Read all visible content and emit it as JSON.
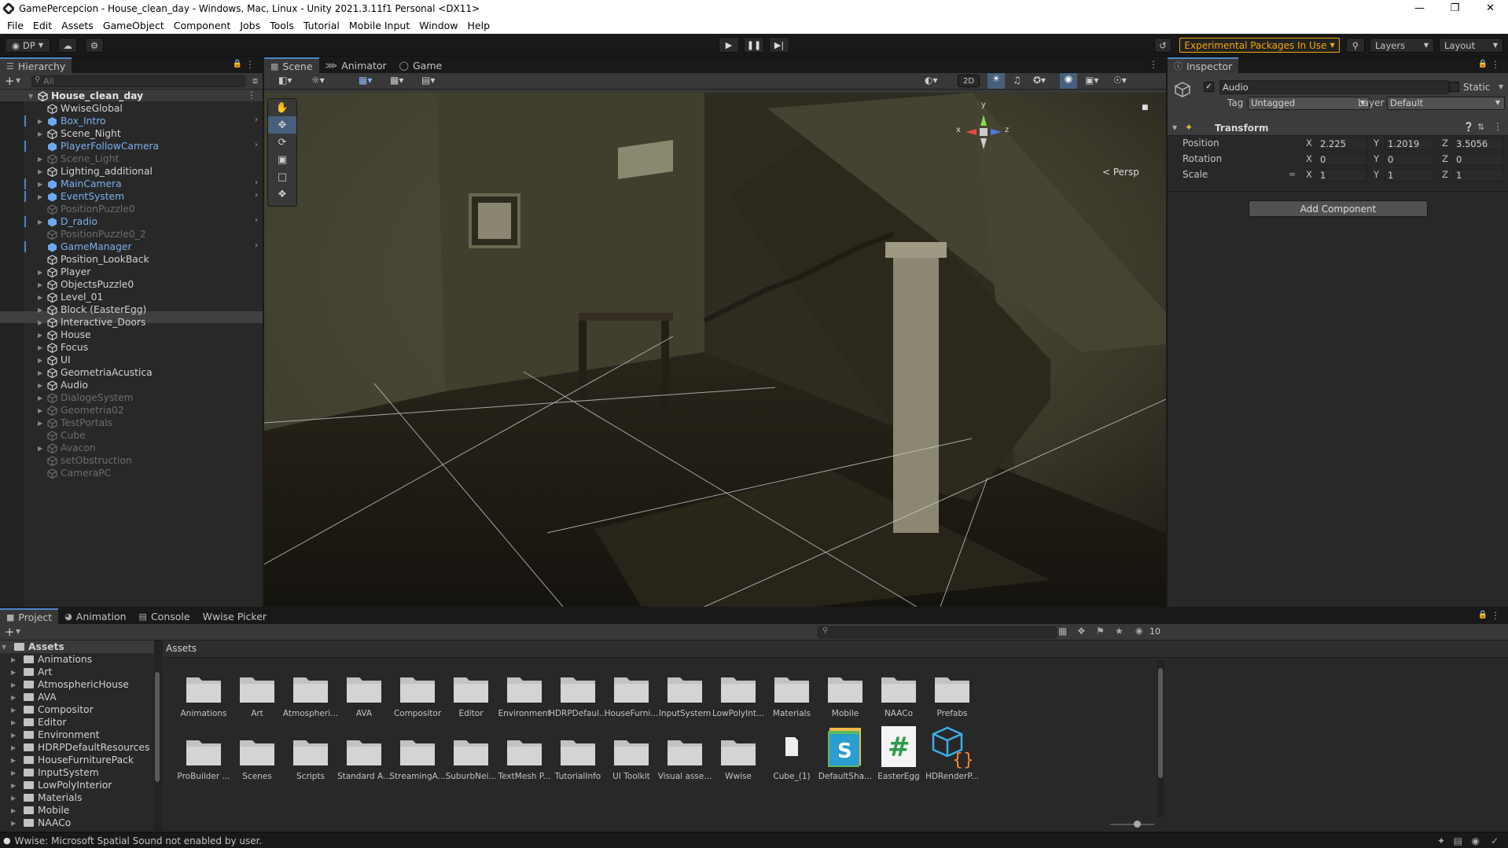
{
  "window": {
    "title": "GamePercepcion - House_clean_day - Windows, Mac, Linux - Unity 2021.3.11f1 Personal <DX11>"
  },
  "menu": [
    "File",
    "Edit",
    "Assets",
    "GameObject",
    "Component",
    "Jobs",
    "Tools",
    "Tutorial",
    "Mobile Input",
    "Window",
    "Help"
  ],
  "toolbar": {
    "account": "DP",
    "experimental": "Experimental Packages In Use",
    "layers": "Layers",
    "layout": "Layout"
  },
  "hierarchy": {
    "tab": "Hierarchy",
    "search_placeholder": "All",
    "scene": "House_clean_day",
    "items": [
      {
        "label": "WwiseGlobal",
        "style": "norm",
        "arrow": false
      },
      {
        "label": "Box_Intro",
        "style": "blue",
        "arrow": true
      },
      {
        "label": "Scene_Night",
        "style": "norm",
        "arrow": true
      },
      {
        "label": "PlayerFollowCamera",
        "style": "blue",
        "arrow": false
      },
      {
        "label": "Scene_Light",
        "style": "dis",
        "arrow": true
      },
      {
        "label": "Lighting_additional",
        "style": "norm",
        "arrow": true
      },
      {
        "label": "MainCamera",
        "style": "blue",
        "arrow": true
      },
      {
        "label": "EventSystem",
        "style": "blue",
        "arrow": true
      },
      {
        "label": "PositionPuzzle0",
        "style": "dis",
        "arrow": false
      },
      {
        "label": "D_radio",
        "style": "blue",
        "arrow": true
      },
      {
        "label": "PositionPuzzle0_2",
        "style": "dis",
        "arrow": false
      },
      {
        "label": "GameManager",
        "style": "blue",
        "arrow": false
      },
      {
        "label": "Position_LookBack",
        "style": "norm",
        "arrow": false
      },
      {
        "label": "Player",
        "style": "norm",
        "arrow": true
      },
      {
        "label": "ObjectsPuzzle0",
        "style": "norm",
        "arrow": true
      },
      {
        "label": "Level_01",
        "style": "norm",
        "arrow": true
      },
      {
        "label": "Block (EasterEgg)",
        "style": "norm",
        "arrow": true
      },
      {
        "label": "Interactive_Doors",
        "style": "norm",
        "arrow": true
      },
      {
        "label": "House",
        "style": "norm",
        "arrow": true
      },
      {
        "label": "Focus",
        "style": "norm",
        "arrow": true
      },
      {
        "label": "UI",
        "style": "norm",
        "arrow": true
      },
      {
        "label": "GeometriaAcustica",
        "style": "norm",
        "arrow": true
      },
      {
        "label": "Audio",
        "style": "norm",
        "arrow": true
      },
      {
        "label": "DialogeSystem",
        "style": "dis",
        "arrow": true
      },
      {
        "label": "Geometria02",
        "style": "dis",
        "arrow": true
      },
      {
        "label": "TestPortals",
        "style": "dis",
        "arrow": true
      },
      {
        "label": "Cube",
        "style": "dis",
        "arrow": false
      },
      {
        "label": "Avacon",
        "style": "dis",
        "arrow": true
      },
      {
        "label": "setObstruction",
        "style": "dis",
        "arrow": false
      },
      {
        "label": "CameraPC",
        "style": "dis",
        "arrow": false
      }
    ]
  },
  "scene_view": {
    "tabs": [
      "Scene",
      "Animator",
      "Game"
    ],
    "mode_2d": "2D",
    "persp_label": "< Persp",
    "gizmo": {
      "y": "y",
      "x": "x",
      "z": "z"
    }
  },
  "inspector": {
    "tab": "Inspector",
    "object_name": "Audio",
    "static_label": "Static",
    "tag_label": "Tag",
    "tag_value": "Untagged",
    "layer_label": "Layer",
    "layer_value": "Default",
    "component": "Transform",
    "position": {
      "label": "Position",
      "x": "2.225",
      "y": "1.2019",
      "z": "3.5056"
    },
    "rotation": {
      "label": "Rotation",
      "x": "0",
      "y": "0",
      "z": "0"
    },
    "scale": {
      "label": "Scale",
      "x": "1",
      "y": "1",
      "z": "1"
    },
    "axis": {
      "x": "X",
      "y": "Y",
      "z": "Z"
    },
    "add_component": "Add Component"
  },
  "bottom": {
    "tabs": [
      "Project",
      "Animation",
      "Console",
      "Wwise Picker"
    ],
    "hidden_count": "10",
    "tree_root": "Assets",
    "tree": [
      "Animations",
      "Art",
      "AtmosphericHouse",
      "AVA",
      "Compositor",
      "Editor",
      "Environment",
      "HDRPDefaultResources",
      "HouseFurniturePack",
      "InputSystem",
      "LowPolyInterior",
      "Materials",
      "Mobile",
      "NAACo"
    ],
    "breadcrumb": "Assets",
    "row1": [
      "Animations",
      "Art",
      "Atmospheri...",
      "AVA",
      "Compositor",
      "Editor",
      "Environment",
      "HDRPDefaul...",
      "HouseFurni...",
      "InputSystem",
      "LowPolyInt...",
      "Materials",
      "Mobile",
      "NAACo",
      "Prefabs"
    ],
    "row2": [
      "ProBuilder ...",
      "Scenes",
      "Scripts",
      "Standard A...",
      "StreamingA...",
      "SuburbNei...",
      "TextMesh P...",
      "TutorialInfo",
      "UI Toolkit",
      "Visual asse...",
      "Wwise",
      "Cube_(1)",
      "DefaultSha...",
      "EasterEgg",
      "HDRenderP..."
    ]
  },
  "status": {
    "message": "Wwise: Microsoft Spatial Sound not enabled by user."
  }
}
